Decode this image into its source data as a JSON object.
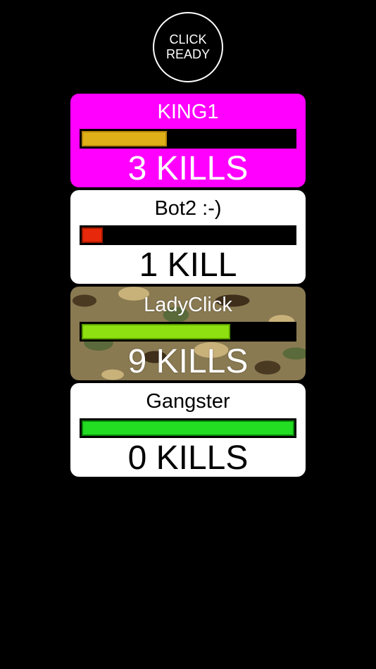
{
  "ready_button": {
    "line1": "CLICK",
    "line2": "READY"
  },
  "players": [
    {
      "name": "KING1",
      "kills_label": "3 KILLS",
      "card_style": "magenta",
      "bar_fill_fraction": 0.4,
      "bar_color": "#e0b018",
      "bar_border": "#b8860b"
    },
    {
      "name": "Bot2 :-)",
      "kills_label": "1 KILL",
      "card_style": "white",
      "bar_fill_fraction": 0.1,
      "bar_color": "#e8280a",
      "bar_border": "#a01a00"
    },
    {
      "name": "LadyClick",
      "kills_label": "9 KILLS",
      "card_style": "camo",
      "bar_fill_fraction": 0.7,
      "bar_color": "#8ee010",
      "bar_border": "#5aa000"
    },
    {
      "name": "Gangster",
      "kills_label": "0 KILLS",
      "card_style": "white",
      "bar_fill_fraction": 1.0,
      "bar_color": "#22dd22",
      "bar_border": "#0a8a0a"
    }
  ]
}
